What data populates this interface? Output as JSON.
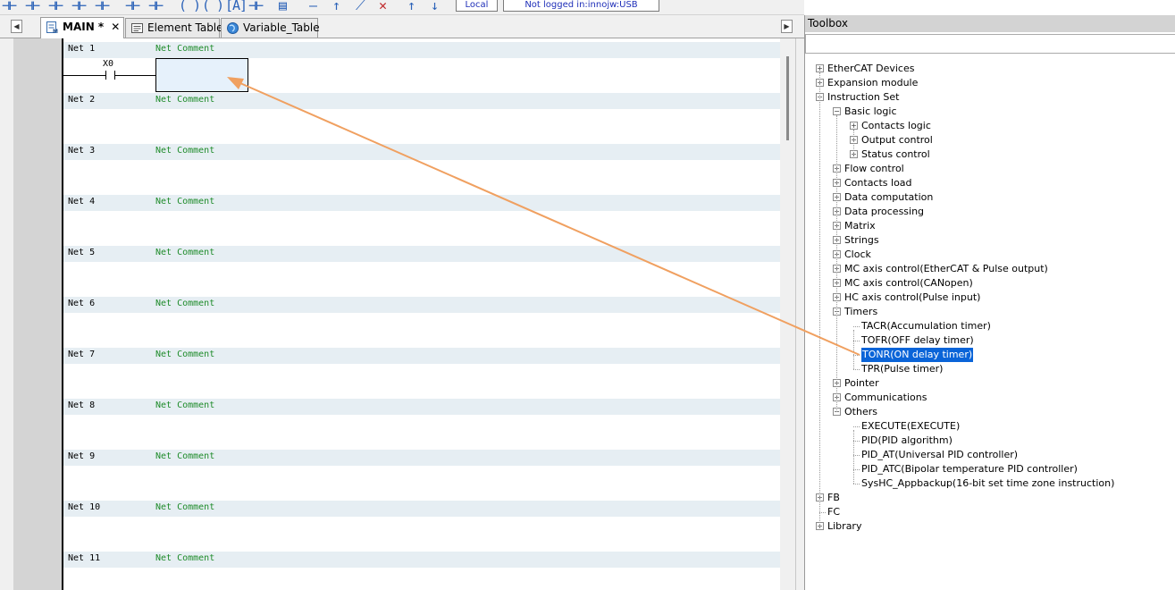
{
  "status": {
    "mode": "Local",
    "login": "Not logged in:innojw:USB"
  },
  "tabs": [
    {
      "label": "MAIN *",
      "icon": "ladder-program-icon",
      "active": true,
      "closable": true
    },
    {
      "label": "Element Table",
      "icon": "table-icon",
      "active": false
    },
    {
      "label": "Variable_Table",
      "icon": "globe-icon",
      "active": false
    }
  ],
  "editor": {
    "nets": [
      {
        "label": "Net 1",
        "comment": "Net Comment"
      },
      {
        "label": "Net 2",
        "comment": "Net Comment"
      },
      {
        "label": "Net 3",
        "comment": "Net Comment"
      },
      {
        "label": "Net 4",
        "comment": "Net Comment"
      },
      {
        "label": "Net 5",
        "comment": "Net Comment"
      },
      {
        "label": "Net 6",
        "comment": "Net Comment"
      },
      {
        "label": "Net 7",
        "comment": "Net Comment"
      },
      {
        "label": "Net 8",
        "comment": "Net Comment"
      },
      {
        "label": "Net 9",
        "comment": "Net Comment"
      },
      {
        "label": "Net 10",
        "comment": "Net Comment"
      },
      {
        "label": "Net 11",
        "comment": "Net Comment"
      }
    ],
    "contact_label": "X0"
  },
  "toolbox": {
    "title": "Toolbox",
    "tree": [
      {
        "label": "EtherCAT Devices",
        "level": 0,
        "exp": "+"
      },
      {
        "label": "Expansion module",
        "level": 0,
        "exp": "+"
      },
      {
        "label": "Instruction Set",
        "level": 0,
        "exp": "-"
      },
      {
        "label": "Basic logic",
        "level": 1,
        "exp": "-"
      },
      {
        "label": "Contacts logic",
        "level": 2,
        "exp": "+"
      },
      {
        "label": "Output control",
        "level": 2,
        "exp": "+"
      },
      {
        "label": "Status control",
        "level": 2,
        "exp": "+"
      },
      {
        "label": "Flow control",
        "level": 1,
        "exp": "+"
      },
      {
        "label": "Contacts load",
        "level": 1,
        "exp": "+"
      },
      {
        "label": "Data computation",
        "level": 1,
        "exp": "+"
      },
      {
        "label": "Data processing",
        "level": 1,
        "exp": "+"
      },
      {
        "label": "Matrix",
        "level": 1,
        "exp": "+"
      },
      {
        "label": "Strings",
        "level": 1,
        "exp": "+"
      },
      {
        "label": "Clock",
        "level": 1,
        "exp": "+"
      },
      {
        "label": "MC axis control(EtherCAT & Pulse output)",
        "level": 1,
        "exp": "+"
      },
      {
        "label": "MC axis control(CANopen)",
        "level": 1,
        "exp": "+"
      },
      {
        "label": "HC axis control(Pulse input)",
        "level": 1,
        "exp": "+"
      },
      {
        "label": "Timers",
        "level": 1,
        "exp": "-"
      },
      {
        "label": "TACR(Accumulation timer)",
        "level": 2,
        "exp": ""
      },
      {
        "label": "TOFR(OFF delay timer)",
        "level": 2,
        "exp": ""
      },
      {
        "label": "TONR(ON delay timer)",
        "level": 2,
        "exp": "",
        "selected": true
      },
      {
        "label": "TPR(Pulse timer)",
        "level": 2,
        "exp": ""
      },
      {
        "label": "Pointer",
        "level": 1,
        "exp": "+"
      },
      {
        "label": "Communications",
        "level": 1,
        "exp": "+"
      },
      {
        "label": "Others",
        "level": 1,
        "exp": "-"
      },
      {
        "label": "EXECUTE(EXECUTE)",
        "level": 2,
        "exp": ""
      },
      {
        "label": "PID(PID algorithm)",
        "level": 2,
        "exp": ""
      },
      {
        "label": "PID_AT(Universal PID controller)",
        "level": 2,
        "exp": ""
      },
      {
        "label": "PID_ATC(Bipolar temperature PID controller)",
        "level": 2,
        "exp": ""
      },
      {
        "label": "SysHC_Appbackup(16-bit set time zone instruction)",
        "level": 2,
        "exp": ""
      },
      {
        "label": "FB",
        "level": 0,
        "exp": "+"
      },
      {
        "label": "FC",
        "level": 0,
        "exp": ""
      },
      {
        "label": "Library",
        "level": 0,
        "exp": "+"
      }
    ]
  },
  "colors": {
    "comment": "#1e8b2a",
    "selection": "#0a64d8",
    "arrow": "#f0a060",
    "net_header": "#e6eef3"
  }
}
